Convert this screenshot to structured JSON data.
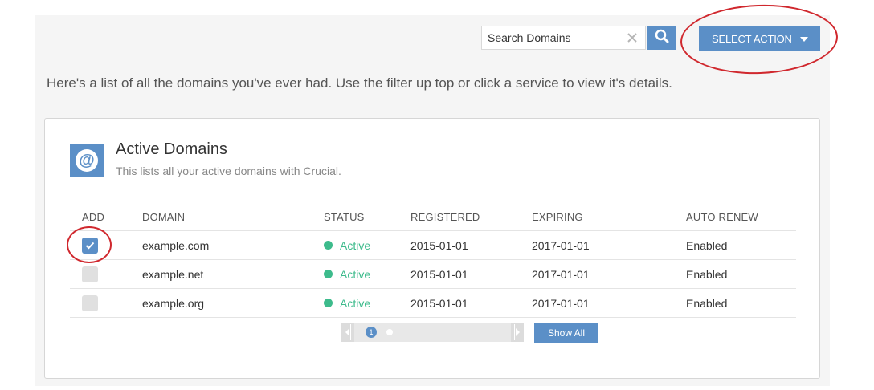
{
  "search": {
    "placeholder": "Search Domains"
  },
  "toolbar": {
    "action_label": "SELECT ACTION"
  },
  "intro_text": "Here's a list of all the domains you've ever had. Use the filter up top or click a service to view it's details.",
  "card": {
    "icon": "at-sign-icon",
    "title": "Active Domains",
    "subtitle": "This lists all your active domains with Crucial."
  },
  "table": {
    "headers": [
      "ADD",
      "DOMAIN",
      "STATUS",
      "REGISTERED",
      "EXPIRING",
      "AUTO RENEW"
    ],
    "rows": [
      {
        "checked": true,
        "domain": "example.com",
        "status": "Active",
        "registered": "2015-01-01",
        "expiring": "2017-01-01",
        "auto_renew": "Enabled"
      },
      {
        "checked": false,
        "domain": "example.net",
        "status": "Active",
        "registered": "2015-01-01",
        "expiring": "2017-01-01",
        "auto_renew": "Enabled"
      },
      {
        "checked": false,
        "domain": "example.org",
        "status": "Active",
        "registered": "2015-01-01",
        "expiring": "2017-01-01",
        "auto_renew": "Enabled"
      }
    ]
  },
  "pagination": {
    "current_page": "1",
    "show_all_label": "Show All"
  },
  "colors": {
    "accent": "#5b8fc7",
    "status_active": "#3dbb8c",
    "annotation": "#d0282e"
  }
}
